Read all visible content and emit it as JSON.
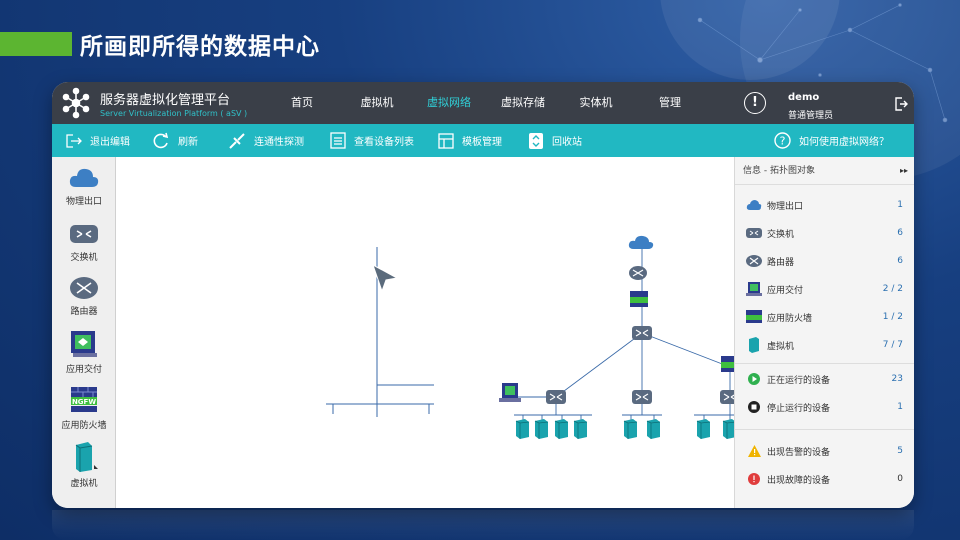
{
  "slide_title": "所画即所得的数据中心",
  "app": {
    "brand_cn": "服务器虚拟化管理平台",
    "brand_en": "Server Virtualization Platform ( aSV )",
    "nav": [
      {
        "label": "首页",
        "active": false
      },
      {
        "label": "虚拟机",
        "active": false
      },
      {
        "label": "虚拟网络",
        "active": true
      },
      {
        "label": "虚拟存储",
        "active": false
      },
      {
        "label": "实体机",
        "active": false
      },
      {
        "label": "管理",
        "active": false
      }
    ],
    "user_icon": "!",
    "user_name": "demo",
    "user_role": "普通管理员"
  },
  "toolbar": {
    "exit_edit": "退出编辑",
    "refresh": "刷新",
    "connectivity": "连通性探测",
    "device_list": "查看设备列表",
    "templates": "模板管理",
    "recycle": "回收站",
    "help": "如何使用虚拟网络？"
  },
  "palette": [
    {
      "label": "物理出口",
      "icon": "cloud-icon"
    },
    {
      "label": "交换机",
      "icon": "switch-icon"
    },
    {
      "label": "路由器",
      "icon": "router-icon"
    },
    {
      "label": "应用交付",
      "icon": "app-delivery-icon"
    },
    {
      "label": "应用防火墙",
      "icon": "ngfw-icon"
    },
    {
      "label": "虚拟机",
      "icon": "vm-icon"
    }
  ],
  "info_panel": {
    "header": "信息 - 拓扑图对象",
    "objects": [
      {
        "label": "物理出口",
        "value": "1",
        "icon": "cloud-icon"
      },
      {
        "label": "交换机",
        "value": "6",
        "icon": "switch-icon"
      },
      {
        "label": "路由器",
        "value": "6",
        "icon": "router-icon"
      },
      {
        "label": "应用交付",
        "value": "2 / 2",
        "icon": "app-delivery-icon"
      },
      {
        "label": "应用防火墙",
        "value": "1 / 2",
        "icon": "ngfw-icon"
      },
      {
        "label": "虚拟机",
        "value": "7 / 7",
        "icon": "vm-icon"
      }
    ],
    "status": [
      {
        "label": "正在运行的设备",
        "value": "23",
        "icon": "running-icon"
      },
      {
        "label": "停止运行的设备",
        "value": "1",
        "icon": "stopped-icon"
      }
    ],
    "alerts": [
      {
        "label": "出现告警的设备",
        "value": "5",
        "icon": "warning-icon"
      },
      {
        "label": "出现故障的设备",
        "value": "0",
        "icon": "error-icon"
      }
    ]
  },
  "colors": {
    "accent": "#21b8c2",
    "nav_bg": "#3a3f48",
    "title_bar": "#5cb531",
    "device": "#5a6a80",
    "vm": "#1aa3ad"
  }
}
